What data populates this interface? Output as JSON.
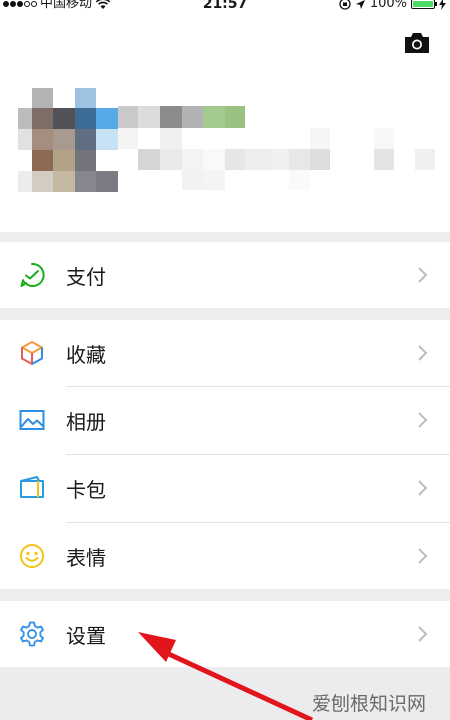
{
  "status": {
    "carrier": "中国移动",
    "time": "21:57",
    "battery": "100%",
    "battery_level": 1.0
  },
  "menu": {
    "pay": "支付",
    "favorites": "收藏",
    "album": "相册",
    "cards": "卡包",
    "stickers": "表情",
    "settings": "设置"
  },
  "footer": {
    "watermark": "爱刨根知识网"
  },
  "colors": {
    "pay_icon": "#1aad19",
    "album_icon": "#2f8ee3",
    "cards_icon": "#2a9ae0",
    "stickers_icon": "#f2c317",
    "settings_icon": "#2f8ee3",
    "annotation_arrow": "#e3151c",
    "page_gap": "#eeeeef"
  }
}
